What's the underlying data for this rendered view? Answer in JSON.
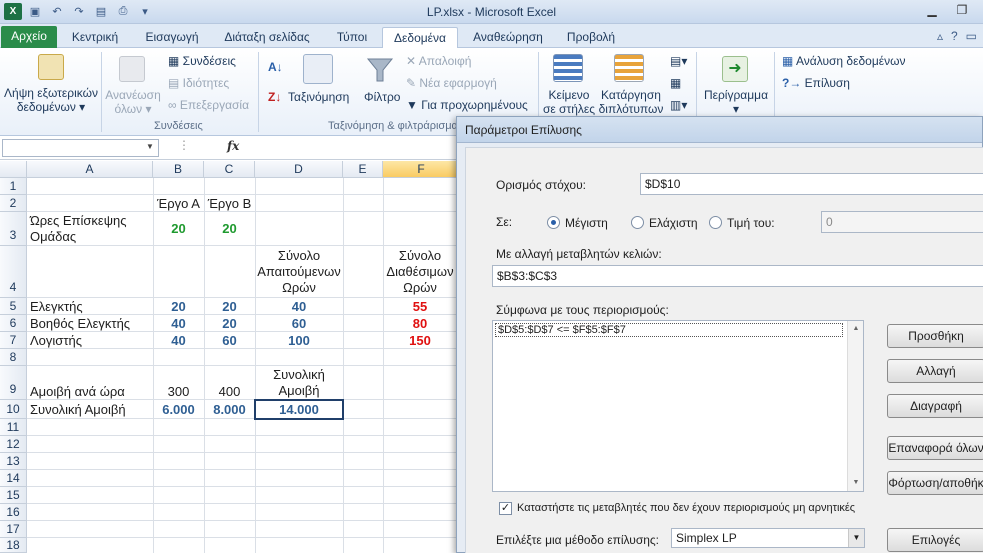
{
  "window": {
    "title": "LP.xlsx  -  Microsoft Excel"
  },
  "tabs": [
    "Αρχείο",
    "Κεντρική",
    "Εισαγωγή",
    "Διάταξη σελίδας",
    "Τύποι",
    "Δεδομένα",
    "Αναθεώρηση",
    "Προβολή"
  ],
  "ribbon": {
    "get_external_1": "Λήψη εξωτερικών",
    "get_external_2": "δεδομένων ▾",
    "refresh_1": "Ανανέωση",
    "refresh_2": "όλων ▾",
    "connections": "Συνδέσεις",
    "properties": "Ιδιότητες",
    "edit_links": "Επεξεργασία",
    "group_connections": "Συνδέσεις",
    "sort": "Ταξινόμηση",
    "filter": "Φίλτρο",
    "clear": "Απαλοιφή",
    "reapply": "Νέα εφαρμογή",
    "advanced": "Για προχωρημένους",
    "group_sort": "Ταξινόμηση & φιλτράρισμα",
    "text_to_cols_1": "Κείμενο",
    "text_to_cols_2": "σε στήλες",
    "remove_dup_1": "Κατάργηση",
    "remove_dup_2": "διπλότυπων",
    "outline": "Περίγραμμα",
    "data_analysis": "Ανάλυση δεδομένων",
    "solver": "Επίλυση"
  },
  "formula_bar": {
    "name_box": "",
    "fx": "fx"
  },
  "sheet": {
    "columns": [
      "A",
      "B",
      "C",
      "D",
      "E",
      "F"
    ],
    "rows": [
      "1",
      "2",
      "3",
      "4",
      "5",
      "6",
      "7",
      "8",
      "9",
      "10",
      "11",
      "12",
      "13",
      "14",
      "15",
      "16",
      "17",
      "18"
    ],
    "B2": "Έργο Α",
    "C2": "Έργο Β",
    "A3": "Ώρες Επίσκεψης Ομάδας",
    "B3": "20",
    "C3": "20",
    "D4": "Σύνολο Απαιτούμενων Ωρών",
    "F4": "Σύνολο Διαθέσιμων Ωρών",
    "A5": "Ελεγκτής",
    "B5": "20",
    "C5": "20",
    "D5": "40",
    "F5": "55",
    "A6": "Βοηθός Ελεγκτής",
    "B6": "40",
    "C6": "20",
    "D6": "60",
    "F6": "80",
    "A7": "Λογιστής",
    "B7": "40",
    "C7": "60",
    "D7": "100",
    "F7": "150",
    "D9": "Συνολική Αμοιβή",
    "A9": "Αμοιβή ανά ώρα",
    "B9": "300",
    "C9": "400",
    "A10": "Συνολική Αμοιβή",
    "B10": "6.000",
    "C10": "8.000",
    "D10": "14.000"
  },
  "solver": {
    "title": "Παράμετροι Επίλυσης",
    "objective_label": "Ορισμός στόχου:",
    "objective_value": "$D$10",
    "to_label": "Σε:",
    "max": "Μέγιστη",
    "min": "Ελάχιστη",
    "value_of": "Τιμή του:",
    "value_input": "0",
    "changing_label": "Με αλλαγή μεταβλητών κελιών:",
    "changing_value": "$B$3:$C$3",
    "constraints_label": "Σύμφωνα με τους περιορισμούς:",
    "constraint_1": "$D$5:$D$7 <= $F$5:$F$7",
    "btn_add": "Προσθήκη",
    "btn_change": "Αλλαγή",
    "btn_delete": "Διαγραφή",
    "btn_reset": "Επαναφορά όλων",
    "btn_load": "Φόρτωση/αποθήκ",
    "nonneg": "Καταστήστε τις μεταβλητές που δεν έχουν περιορισμούς μη αρνητικές",
    "method_label": "Επιλέξτε μια μέθοδο επίλυσης:",
    "method_value": "Simplex LP",
    "btn_options": "Επιλογές"
  }
}
